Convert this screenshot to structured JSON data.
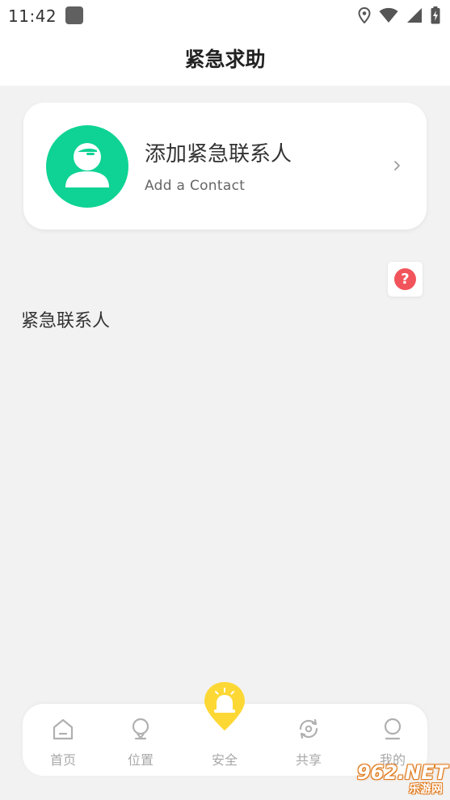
{
  "status_bar": {
    "time": "11:42",
    "icons": [
      "app-square-icon",
      "location-icon",
      "wifi-icon",
      "signal-icon",
      "battery-charging-icon"
    ]
  },
  "header": {
    "title": "紧急求助"
  },
  "add_contact_card": {
    "title": "添加紧急联系人",
    "subtitle": "Add a  Contact",
    "avatar_icon": "person-icon",
    "chevron_icon": "chevron-right-icon",
    "avatar_color": "#0ed394"
  },
  "help_button": {
    "glyph": "?",
    "color": "#f2545b"
  },
  "section": {
    "label": "紧急联系人"
  },
  "tab_bar": {
    "tabs": [
      {
        "label": "首页",
        "icon": "home-icon"
      },
      {
        "label": "位置",
        "icon": "location-pin-icon"
      },
      {
        "label": "安全",
        "icon": "alarm-icon",
        "active": true
      },
      {
        "label": "共享",
        "icon": "share-sync-icon"
      },
      {
        "label": "我的",
        "icon": "profile-icon"
      }
    ],
    "active_color": "#fdd835",
    "inactive_color": "#a8a8a8"
  },
  "watermark": {
    "text": "962.NET",
    "sub": "乐游网"
  }
}
